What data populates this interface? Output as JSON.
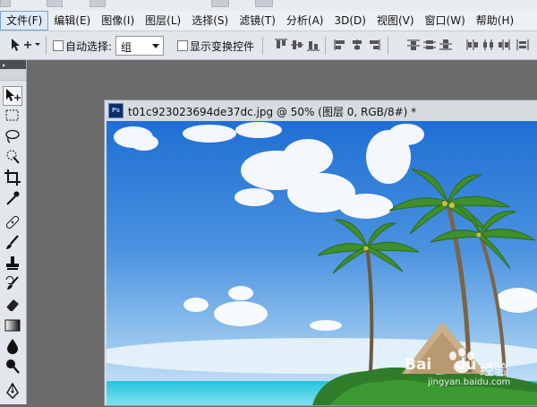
{
  "menu": {
    "items": [
      {
        "label": "文件(F)",
        "active": true
      },
      {
        "label": "编辑(E)",
        "active": false
      },
      {
        "label": "图像(I)",
        "active": false
      },
      {
        "label": "图层(L)",
        "active": false
      },
      {
        "label": "选择(S)",
        "active": false
      },
      {
        "label": "滤镜(T)",
        "active": false
      },
      {
        "label": "分析(A)",
        "active": false
      },
      {
        "label": "3D(D)",
        "active": false
      },
      {
        "label": "视图(V)",
        "active": false
      },
      {
        "label": "窗口(W)",
        "active": false
      },
      {
        "label": "帮助(H)",
        "active": false
      }
    ]
  },
  "options": {
    "auto_select_label": "自动选择:",
    "auto_select_checked": false,
    "auto_select_value": "组",
    "show_transform_label": "显示变换控件",
    "show_transform_checked": false,
    "align_icons": [
      "align-top-icon",
      "align-vcenter-icon",
      "align-bottom-icon",
      "align-left-icon",
      "align-hcenter-icon",
      "align-right-icon",
      "distribute-top-icon",
      "distribute-vcenter-icon",
      "distribute-bottom-icon",
      "distribute-left-icon",
      "distribute-hcenter-icon",
      "distribute-right-icon"
    ]
  },
  "tools": [
    "move-tool-icon",
    "marquee-tool-icon",
    "lasso-tool-icon",
    "quick-select-tool-icon",
    "crop-tool-icon",
    "eyedropper-tool-icon",
    "healing-brush-tool-icon",
    "brush-tool-icon",
    "clone-stamp-tool-icon",
    "history-brush-tool-icon",
    "eraser-tool-icon",
    "gradient-tool-icon",
    "blur-tool-icon",
    "dodge-tool-icon",
    "pen-tool-icon"
  ],
  "document": {
    "badge": "Ps",
    "title": "t01c923023694de37dc.jpg @ 50% (图层 0, RGB/8#) *"
  },
  "watermark": {
    "brand": "Bai",
    "brand_du": "du",
    "suffix": "经验",
    "url": "jingyan.baidu.com"
  },
  "colors": {
    "accent": "#7aa1d6",
    "workspace": "#6b6b6b",
    "panel": "#e3e6ea",
    "sky_top": "#1f6fd3",
    "sea": "#27c3de"
  }
}
